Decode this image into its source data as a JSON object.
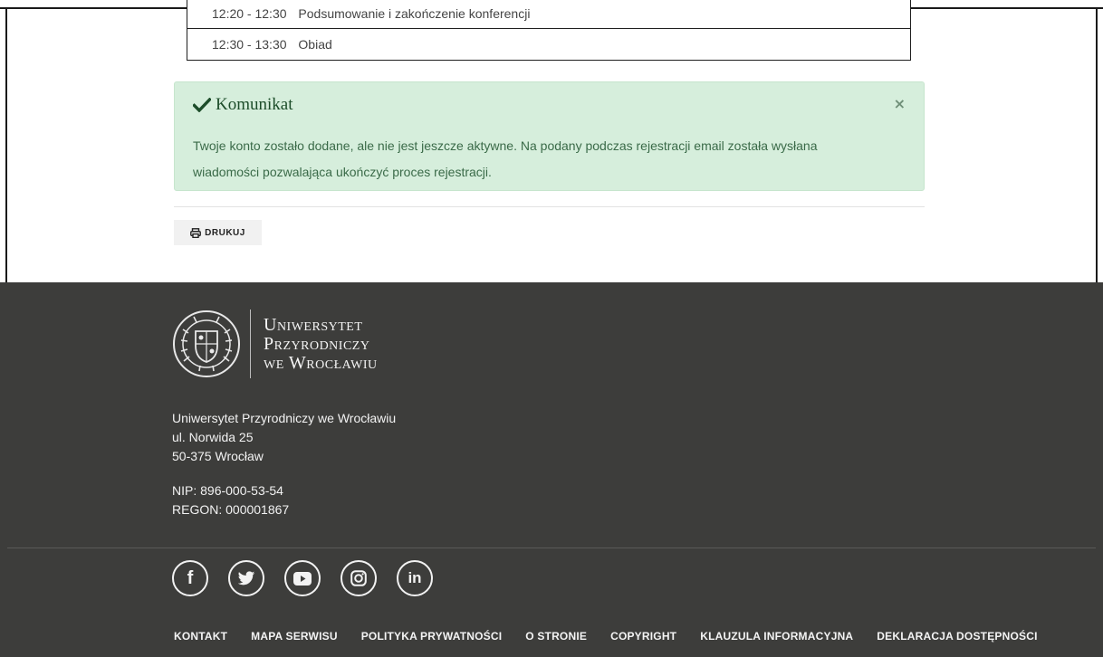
{
  "agenda": {
    "rows": [
      {
        "time": "12:20 - 12:30",
        "label": "Podsumowanie i zakończenie konferencji"
      },
      {
        "time": "12:30 - 13:30",
        "label": "Obiad"
      }
    ]
  },
  "alert": {
    "title": "Komunikat",
    "close": "×",
    "message": "Twoje konto zostało dodane, ale nie jest jeszcze aktywne. Na podany podczas rejestracji email została wysłana wiadomości pozwalająca ukończyć proces rejestracji.",
    "color": "#d6eedc"
  },
  "print": {
    "label": "DRUKUJ"
  },
  "footer": {
    "logo_lines": [
      "Uniwersytet",
      "Przyrodniczy",
      "we Wrocławiu"
    ],
    "address": [
      "Uniwersytet Przyrodniczy we Wrocławiu",
      "ul. Norwida 25",
      "50-375 Wrocław"
    ],
    "ids": [
      "NIP: 896-000-53-54",
      "REGON: 000001867"
    ],
    "social": [
      {
        "name": "facebook",
        "glyph": "f"
      },
      {
        "name": "twitter",
        "glyph": ""
      },
      {
        "name": "youtube",
        "glyph": ""
      },
      {
        "name": "instagram",
        "glyph": ""
      },
      {
        "name": "linkedin",
        "glyph": "in"
      }
    ],
    "links": [
      "KONTAKT",
      "MAPA SERWISU",
      "POLITYKA PRYWATNOŚCI",
      "O STRONIE",
      "COPYRIGHT",
      "KLAUZULA INFORMACYJNA",
      "DEKLARACJA DOSTĘPNOŚCI"
    ],
    "background": "#3d3d3b"
  }
}
